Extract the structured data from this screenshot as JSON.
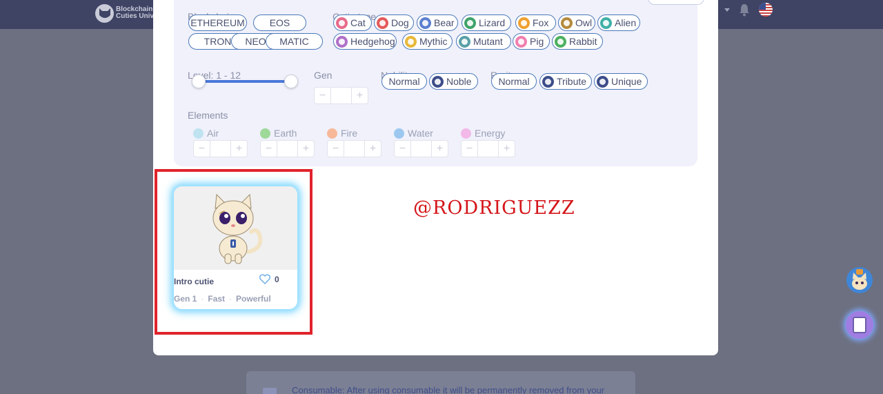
{
  "header": {
    "logo_text": "Blockchain\nCuties Univer"
  },
  "filters": {
    "blockchain_label": "Blockchain",
    "blockchains": [
      "ETHEREUM",
      "EOS",
      "TRON",
      "NEO",
      "MATIC"
    ],
    "cutie_type_label": "Cutie type",
    "cutie_types": [
      {
        "label": "Cat",
        "color": "#e86a8a"
      },
      {
        "label": "Dog",
        "color": "#e55a5a"
      },
      {
        "label": "Bear",
        "color": "#5b7fd0"
      },
      {
        "label": "Lizard",
        "color": "#3fa36a"
      },
      {
        "label": "Fox",
        "color": "#f0a030"
      },
      {
        "label": "Owl",
        "color": "#b58a3e"
      },
      {
        "label": "Alien",
        "color": "#3fb0a8"
      },
      {
        "label": "Hedgehog",
        "color": "#b070c8"
      },
      {
        "label": "Mythic",
        "color": "#e8b83a"
      },
      {
        "label": "Mutant",
        "color": "#5aa0a8"
      },
      {
        "label": "Pig",
        "color": "#f07fb0"
      },
      {
        "label": "Rabbit",
        "color": "#4cb060"
      }
    ],
    "level_label": "Level: 1 - 12",
    "level_range": [
      1,
      12
    ],
    "gen_label": "Gen",
    "nobility_label": "Nobility",
    "nobility": [
      {
        "label": "Normal",
        "icon": "none"
      },
      {
        "label": "Noble",
        "icon": "crown-icon",
        "color": "#3d4d8a"
      }
    ],
    "rarity_label": "Rarity",
    "rarity": [
      {
        "label": "Normal",
        "icon": "none"
      },
      {
        "label": "Tribute",
        "icon": "diamond-icon",
        "color": "#3d4d8a"
      },
      {
        "label": "Unique",
        "icon": "unique-icon",
        "color": "#3d4d8a"
      }
    ],
    "elements_label": "Elements",
    "elements": [
      {
        "label": "Air",
        "color": "#bfe3f0"
      },
      {
        "label": "Earth",
        "color": "#9fd99a"
      },
      {
        "label": "Fire",
        "color": "#f7b89a"
      },
      {
        "label": "Water",
        "color": "#9cc8f0"
      },
      {
        "label": "Energy",
        "color": "#f2b8e8"
      }
    ]
  },
  "card": {
    "name": "Intro cutie",
    "likes": "0",
    "gen": "Gen 1",
    "speed": "Fast",
    "power": "Powerful"
  },
  "watermark": "@RODRIGUEZZ",
  "notice": {
    "text": "Consumable: After using consumable it will be permanently removed from your"
  },
  "colors": {
    "highlight": "#e0232b",
    "accent": "#4a78d8",
    "card_glow": "#8fdcff"
  }
}
